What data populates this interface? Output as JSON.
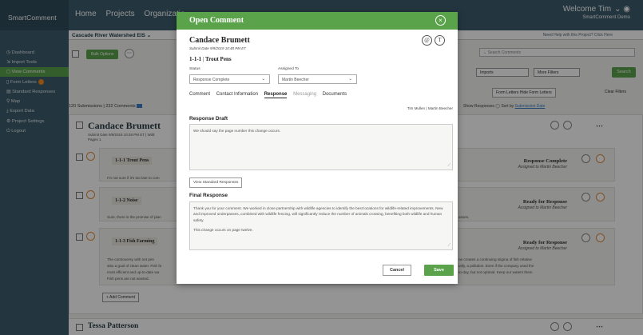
{
  "app": {
    "brand": "SmartComment",
    "topnav": [
      "Home",
      "Projects",
      "Organizatio"
    ],
    "welcome": "Welcome Tim",
    "welcome_sub": "SmartComment Demo",
    "project": "Cascade River Watershed EIS",
    "help_text": "Need Help with this Project? Click Here"
  },
  "sidebar": {
    "items": [
      {
        "label": "Dashboard"
      },
      {
        "label": "Import Tools"
      },
      {
        "label": "View Comments",
        "active": true
      },
      {
        "label": "Form Letters"
      },
      {
        "label": "Standard Responses"
      },
      {
        "label": "Map"
      },
      {
        "label": "Export Data"
      },
      {
        "label": "Project Settings"
      },
      {
        "label": "Logout"
      }
    ]
  },
  "toolbar": {
    "bulk_options": "Bulk Options",
    "search_placeholder": "Search Comments",
    "filter_imports": "Imports",
    "filter_more": "More Filters",
    "search_button": "Search",
    "form_letter_filter": "Form Letters Hide Form Letters",
    "clear_filters": "Clear Filters",
    "submissions": "120 Submissions | 232 Comments",
    "show_responses": "Show Responses",
    "sort_by": "Sort by",
    "sort_value": "Submission Date"
  },
  "background_cards": [
    {
      "name": "Candace Brumett",
      "meta": "Submit Date 9/9/2019 10:48 PM ET | Wild",
      "meta2": "Pages 1",
      "responses": [
        {
          "id": "1-1-1",
          "topic": "Trout Pens",
          "text": "I'm not sure if it's too late to com",
          "status": "Response Complete",
          "assignee": "Assigned to Martin Beecher"
        },
        {
          "id": "1-1-2",
          "topic": "Noise",
          "text": "Sure, there is the promise of plan",
          "status": "Ready for Response",
          "assignee": "Assigned to Martin Beecher",
          "text_right": "asses."
        },
        {
          "id": "1-1-3",
          "topic": "Fish Farming",
          "text": "The controversy with net pen",
          "text2": "also a goal of clean water. Fish fa",
          "text3": "most efficient and up-to-date wa",
          "text4": "Fish pens are not wanted.",
          "status": "Ready for Response",
          "assignee": "Assigned to Martin Beecher",
          "right1": "ne creates a continuing stigma of fish relative",
          "right2": "tally, a pollution. Even if the company used the",
          "right3": "to-day, but not optimal. Keep our waters them"
        }
      ],
      "add_comment": "+ Add Comment"
    },
    {
      "name": "Tessa Patterson"
    }
  ],
  "modal": {
    "title": "Open Comment",
    "close_symbol": "×",
    "commenter": "Candace Brumett",
    "submit_date": "Submit Date 9/9/2019 10:48 PM ET",
    "comment_id": "1-1-1",
    "comment_topic": "Trout Pens",
    "status_label": "Status",
    "status_value": "Response Complete",
    "assigned_label": "Assigned To",
    "assigned_value": "Martin Beecher",
    "tabs": [
      "Comment",
      "Contact Information",
      "Response",
      "Messaging",
      "Documents"
    ],
    "active_tab": "Response",
    "author": "Tim Mullen | Martin Beecher",
    "response_draft_label": "Response Draft",
    "response_draft_text": "We should say the page number this change occurs.",
    "view_standard_button": "View Standard Responses",
    "final_response_label": "Final Response",
    "final_response_p1": "Thank you for your comment. We worked in close partnership with wildlife agencies to identify the best locations for wildlife-related improvements. New and improved underpasses, combined with wildlife fencing, will significantly reduce the number of animals crossing, benefiting both wildlife and human safety.",
    "final_response_p2": "This change occurs on page twelve.",
    "cancel_button": "Cancel",
    "save_button": "Save"
  },
  "colors": {
    "brand_green": "#5aa34a",
    "nav_dark": "#3d5c6b",
    "badge_orange": "#f08a24"
  }
}
